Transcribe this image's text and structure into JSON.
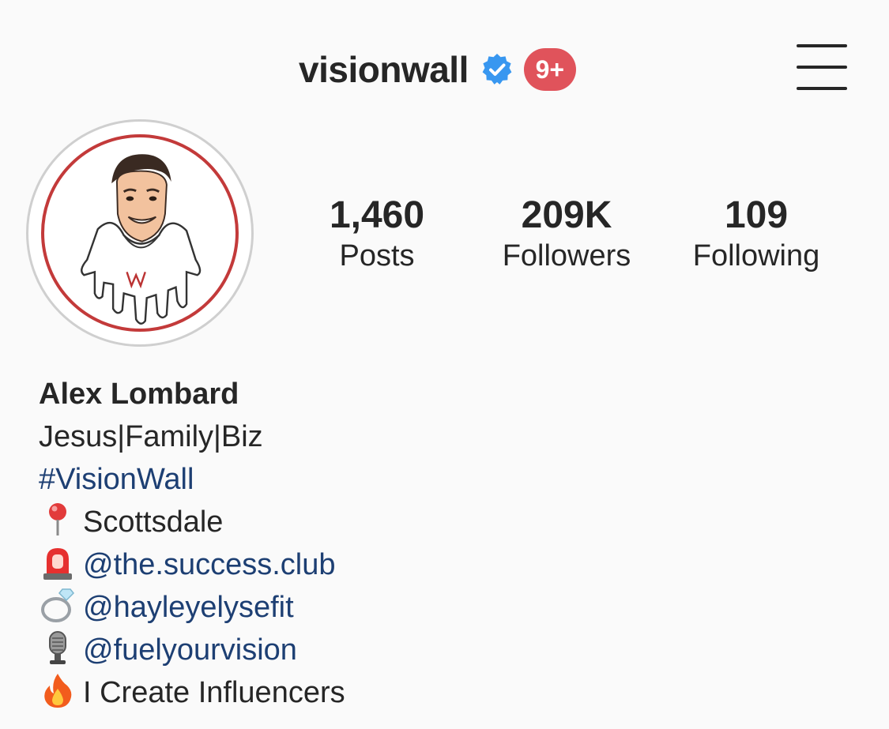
{
  "header": {
    "username": "visionwall",
    "verified_icon": "verified-badge-icon",
    "notification_badge": "9+",
    "menu_icon": "hamburger-menu-icon"
  },
  "profile": {
    "avatar_icon": "profile-avatar"
  },
  "stats": {
    "posts": {
      "value": "1,460",
      "label": "Posts"
    },
    "followers": {
      "value": "209K",
      "label": "Followers"
    },
    "following": {
      "value": "109",
      "label": "Following"
    }
  },
  "bio": {
    "name": "Alex Lombard",
    "tagline": "Jesus|Family|Biz",
    "hashtag": "#VisionWall",
    "location": {
      "icon": "round-pushpin-icon",
      "text": "Scottsdale"
    },
    "links": [
      {
        "icon": "police-light-icon",
        "text": "@the.success.club"
      },
      {
        "icon": "ring-icon",
        "text": "@hayleyelysefit"
      },
      {
        "icon": "microphone-icon",
        "text": "@fuelyourvision"
      }
    ],
    "closing": {
      "icon": "fire-icon",
      "text": "I Create Influencers"
    }
  },
  "colors": {
    "background": "#fafafa",
    "text": "#262626",
    "link": "#1d3f73",
    "verified": "#3897f0",
    "badge": "#e0535b",
    "avatar_border": "#c33a3a"
  }
}
